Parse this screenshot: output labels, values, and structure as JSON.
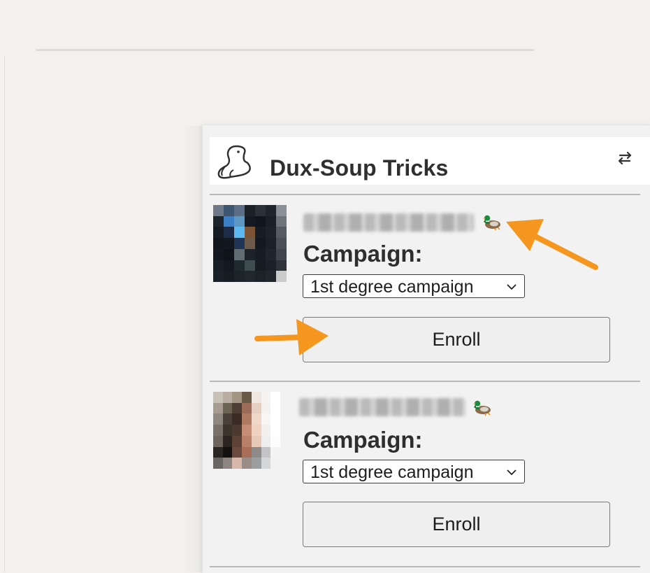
{
  "panel": {
    "title": "Dux-Soup Tricks",
    "logo_icon": "duck-head-outline-icon",
    "swap_icon": "swap-arrows-icon"
  },
  "profiles": [
    {
      "name": "",
      "name_blurred": true,
      "badge_icon": "mallard-duck-icon",
      "campaign_label": "Campaign:",
      "campaign_selected": "1st degree campaign",
      "enroll_label": "Enroll"
    },
    {
      "name": "",
      "name_blurred": true,
      "badge_icon": "mallard-duck-icon",
      "campaign_label": "Campaign:",
      "campaign_selected": "1st degree campaign",
      "enroll_label": "Enroll"
    }
  ],
  "annotations": {
    "arrow_color": "#f5961e"
  },
  "colors": {
    "background": "#f2f1ee",
    "panel": "#f2f2f2",
    "header": "#ffffff",
    "text": "#2f2f2f"
  }
}
